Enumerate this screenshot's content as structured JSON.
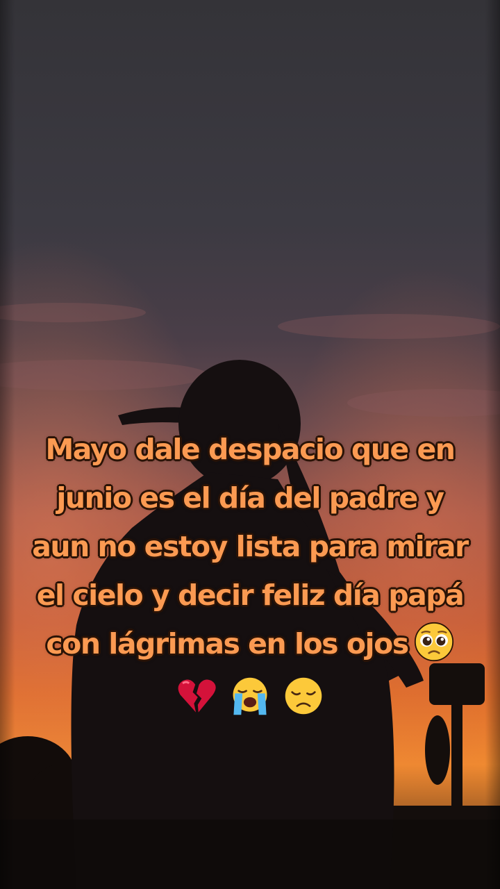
{
  "overlay": {
    "caption_lines": [
      "Mayo dale despacio que en",
      "junio es el día del padre y",
      "aun no estoy lista para mirar",
      "el cielo y decir feliz día papá",
      "con lágrimas en los ojos"
    ],
    "inline_emoji": "pleading-face-icon",
    "emoji_row": [
      "broken-heart-icon",
      "loudly-crying-face-icon",
      "disappointed-face-icon"
    ],
    "caption_color": "#fb9a52"
  },
  "background": {
    "description_colors": {
      "sky_top": "#35363c",
      "sky_mid": "#5d4650",
      "sunset_glow": "#e06a2a",
      "horizon": "#f07a22",
      "silhouette": "#140f10"
    }
  }
}
